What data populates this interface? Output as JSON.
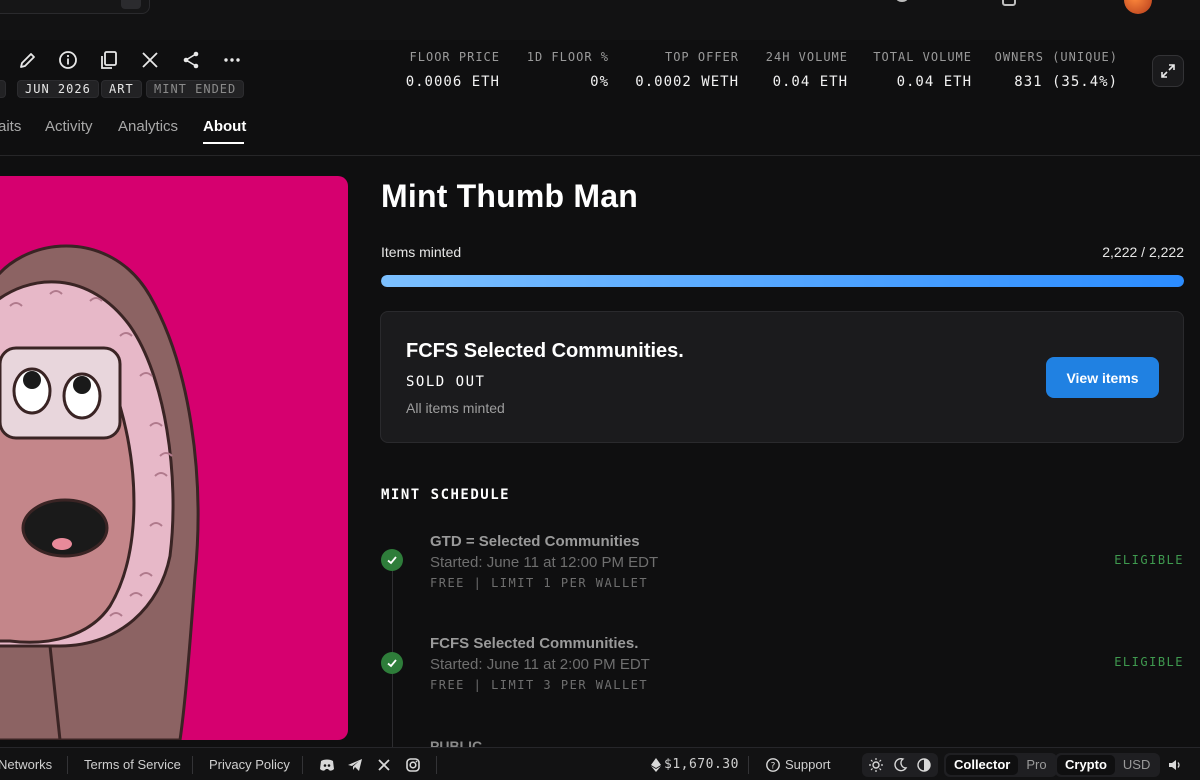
{
  "actions": {
    "icons": [
      "edit-icon",
      "info-icon",
      "copy-icon",
      "x-icon",
      "share-icon",
      "more-icon"
    ]
  },
  "tags": [
    "JUN 2026",
    "ART",
    "MINT ENDED"
  ],
  "stats": [
    {
      "label": "FLOOR PRICE",
      "value": "0.0006 ETH"
    },
    {
      "label": "1D FLOOR %",
      "value": "0%"
    },
    {
      "label": "TOP OFFER",
      "value": "0.0002 WETH"
    },
    {
      "label": "24H VOLUME",
      "value": "0.04 ETH"
    },
    {
      "label": "TOTAL VOLUME",
      "value": "0.04 ETH"
    },
    {
      "label": "OWNERS (UNIQUE)",
      "value": "831 (35.4%)"
    }
  ],
  "tabs": [
    "aits",
    "Activity",
    "Analytics",
    "About"
  ],
  "active_tab": "About",
  "collection": {
    "title": "Mint Thumb Man",
    "items_minted_label": "Items minted",
    "items_minted_count": "2,222 / 2,222",
    "progress_fraction": 1.0
  },
  "current_phase": {
    "title": "FCFS Selected Communities.",
    "status": "SOLD OUT",
    "subtitle": "All items minted",
    "button_label": "View items"
  },
  "schedule": {
    "heading": "MINT SCHEDULE",
    "phases": [
      {
        "name": "GTD = Selected Communities",
        "time": "Started: June 11 at 12:00 PM EDT",
        "limit": "FREE | LIMIT 1 PER WALLET",
        "eligibility": "ELIGIBLE"
      },
      {
        "name": "FCFS Selected Communities.",
        "time": "Started: June 11 at 2:00 PM EDT",
        "limit": "FREE | LIMIT 3 PER WALLET",
        "eligibility": "ELIGIBLE"
      }
    ],
    "next_phase_name": "PUBLIC"
  },
  "footer": {
    "links": [
      "Networks",
      "Terms of Service",
      "Privacy Policy"
    ],
    "social_icons": [
      "discord-icon",
      "telegram-icon",
      "x-icon",
      "instagram-icon"
    ],
    "eth_price": "$1,670.30",
    "support_label": "Support",
    "mode_options": [
      "Collector",
      "Pro"
    ],
    "mode_selected": "Collector",
    "currency_options": [
      "Crypto",
      "USD"
    ],
    "currency_selected": "Crypto",
    "theme_icons": [
      "sun-icon",
      "moon-icon",
      "contrast-icon"
    ]
  },
  "colors": {
    "background": "#0f0f10",
    "accent": "#2081e2",
    "artwork_bg": "#d6006f",
    "eligible": "#3f9a4f"
  }
}
